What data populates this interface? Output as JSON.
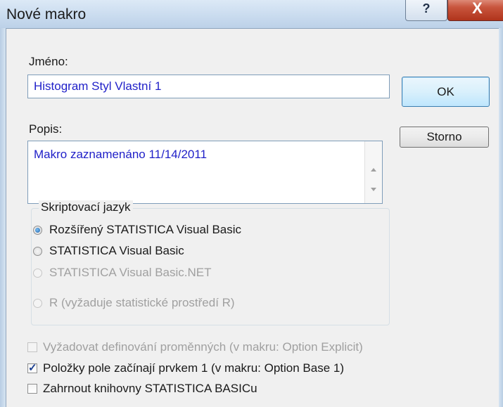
{
  "window": {
    "title": "Nové makro",
    "help_glyph": "?",
    "close_glyph": "X"
  },
  "form": {
    "name_label": "Jméno:",
    "name_value": "Histogram Styl Vlastní 1",
    "description_label": "Popis:",
    "description_value": "Makro zaznamenáno 11/14/2011"
  },
  "buttons": {
    "ok": "OK",
    "cancel": "Storno"
  },
  "script_language": {
    "title": "Skriptovací jazyk",
    "options": [
      {
        "label": "Rozšířený STATISTICA Visual Basic",
        "selected": true,
        "enabled": true
      },
      {
        "label": "STATISTICA Visual Basic",
        "selected": false,
        "enabled": true
      },
      {
        "label": "STATISTICA Visual Basic.NET",
        "selected": false,
        "enabled": false
      },
      {
        "label": "R  (vyžaduje statistické prostředí R)",
        "selected": false,
        "enabled": false
      }
    ]
  },
  "options": [
    {
      "label": "Vyžadovat definování proměnných (v makru: Option Explicit)",
      "checked": false,
      "enabled": false
    },
    {
      "label": "Položky pole začínají prvkem 1 (v makru: Option Base 1)",
      "checked": true,
      "enabled": true
    },
    {
      "label": "Zahrnout knihovny STATISTICA BASICu",
      "checked": false,
      "enabled": true
    }
  ],
  "colors": {
    "input_text": "#1f1fc8",
    "disabled_text": "#a0a0a0",
    "close_button": "#c8553d"
  }
}
